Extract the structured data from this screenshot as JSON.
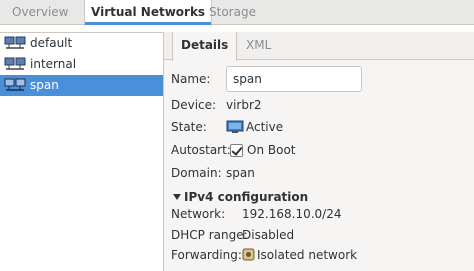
{
  "tabs": [
    {
      "label": "Overview"
    },
    {
      "label": "Virtual Networks"
    },
    {
      "label": "Storage"
    }
  ],
  "networks": [
    {
      "label": "default"
    },
    {
      "label": "internal"
    },
    {
      "label": "span"
    }
  ],
  "subtabs": [
    {
      "label": "Details"
    },
    {
      "label": "XML"
    }
  ],
  "details": {
    "name_label": "Name:",
    "name_value": "span",
    "device_label": "Device:",
    "device_value": "virbr2",
    "state_label": "State:",
    "state_value": "Active",
    "autostart_label": "Autostart:",
    "autostart_value": "On Boot",
    "domain_label": "Domain:",
    "domain_value": "span"
  },
  "ipv4": {
    "heading": "IPv4 configuration",
    "network_label": "Network:",
    "network_value": "192.168.10.0/24",
    "dhcp_label": "DHCP range:",
    "dhcp_value": "Disabled",
    "forwarding_label": "Forwarding:",
    "forwarding_value": "Isolated network"
  },
  "colors": {
    "selection": "#4a90d9",
    "active_tab_underline": "#4a90d9"
  }
}
